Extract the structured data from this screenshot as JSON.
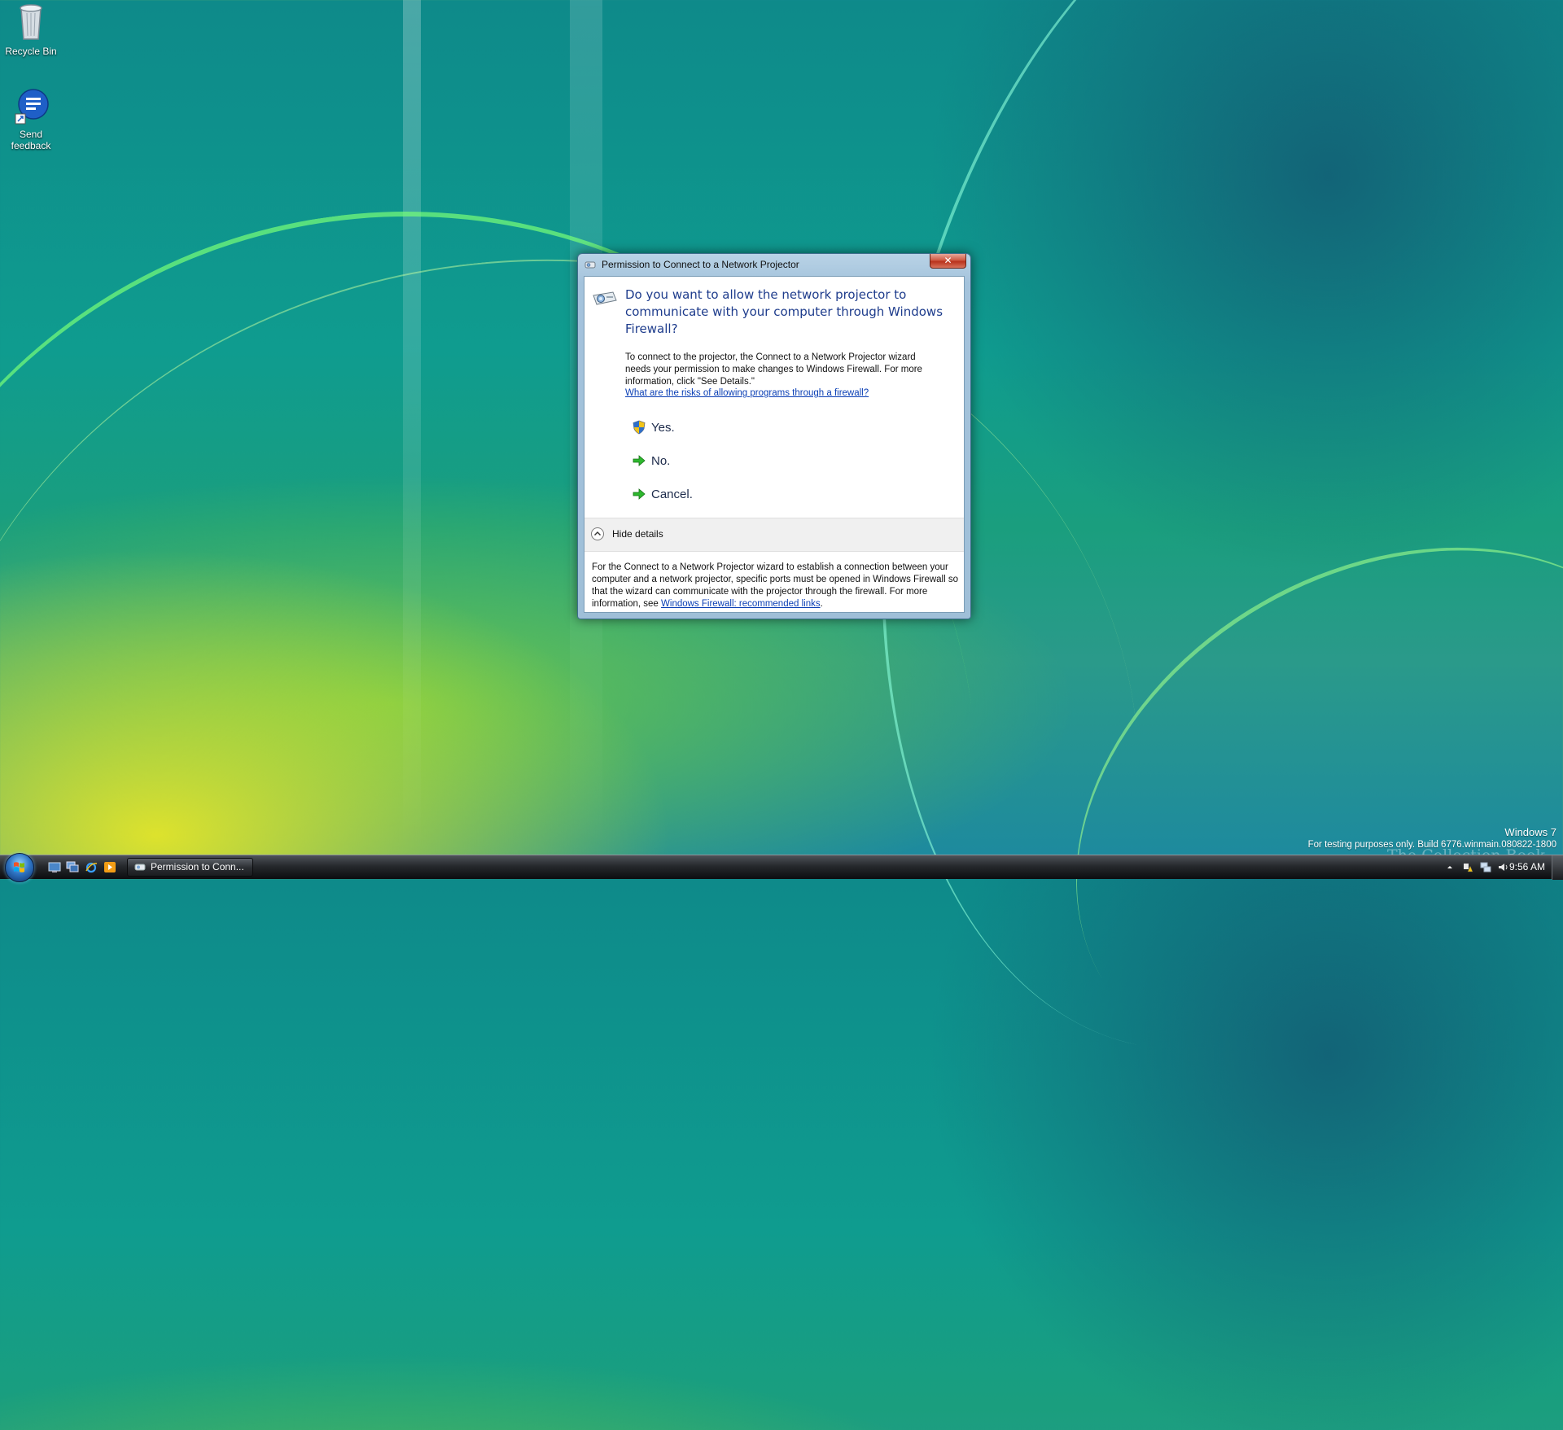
{
  "desktop": {
    "icons": [
      {
        "label": "Recycle Bin",
        "icon": "recycle-bin-icon"
      },
      {
        "label": "Send feedback",
        "icon": "send-feedback-icon"
      }
    ],
    "watermark": {
      "line1": "Windows 7",
      "line2": "For testing purposes only. Build 6776.winmain.080822-1800",
      "overlay": "The Collection Book"
    }
  },
  "dialog": {
    "title": "Permission to Connect to a Network Projector",
    "close_glyph": "✕",
    "main_instruction": "Do you want to allow the network projector to communicate with your computer through Windows Firewall?",
    "content": "To connect to the projector, the Connect to a Network Projector wizard needs your permission to make changes to Windows Firewall. For more information, click \"See Details.\"",
    "risk_link": "What are the risks of allowing programs through a firewall?",
    "commands": [
      {
        "label": "Yes.",
        "icon": "uac-shield-icon"
      },
      {
        "label": "No.",
        "icon": "green-arrow-icon"
      },
      {
        "label": "Cancel.",
        "icon": "green-arrow-icon"
      }
    ],
    "details_toggle": "Hide details",
    "details_text": "For the Connect to a Network Projector wizard to establish a connection between your computer and a network projector, specific ports must be opened in Windows Firewall so that the wizard can communicate with the projector through the firewall. For more information, see",
    "details_link": "Windows Firewall: recommended links",
    "details_end": "."
  },
  "taskbar": {
    "task_button": "Permission to Conn...",
    "clock": "9:56 AM",
    "quick_launch": [
      "show-desktop-icon",
      "switch-windows-icon",
      "internet-explorer-icon",
      "media-player-icon"
    ],
    "tray": [
      "show-hidden-icons-icon",
      "action-center-icon",
      "network-icon",
      "volume-icon"
    ]
  },
  "colors": {
    "instruction_blue": "#1e3c8c",
    "link_blue": "#0b3fb5",
    "close_red": "#c8402a"
  }
}
